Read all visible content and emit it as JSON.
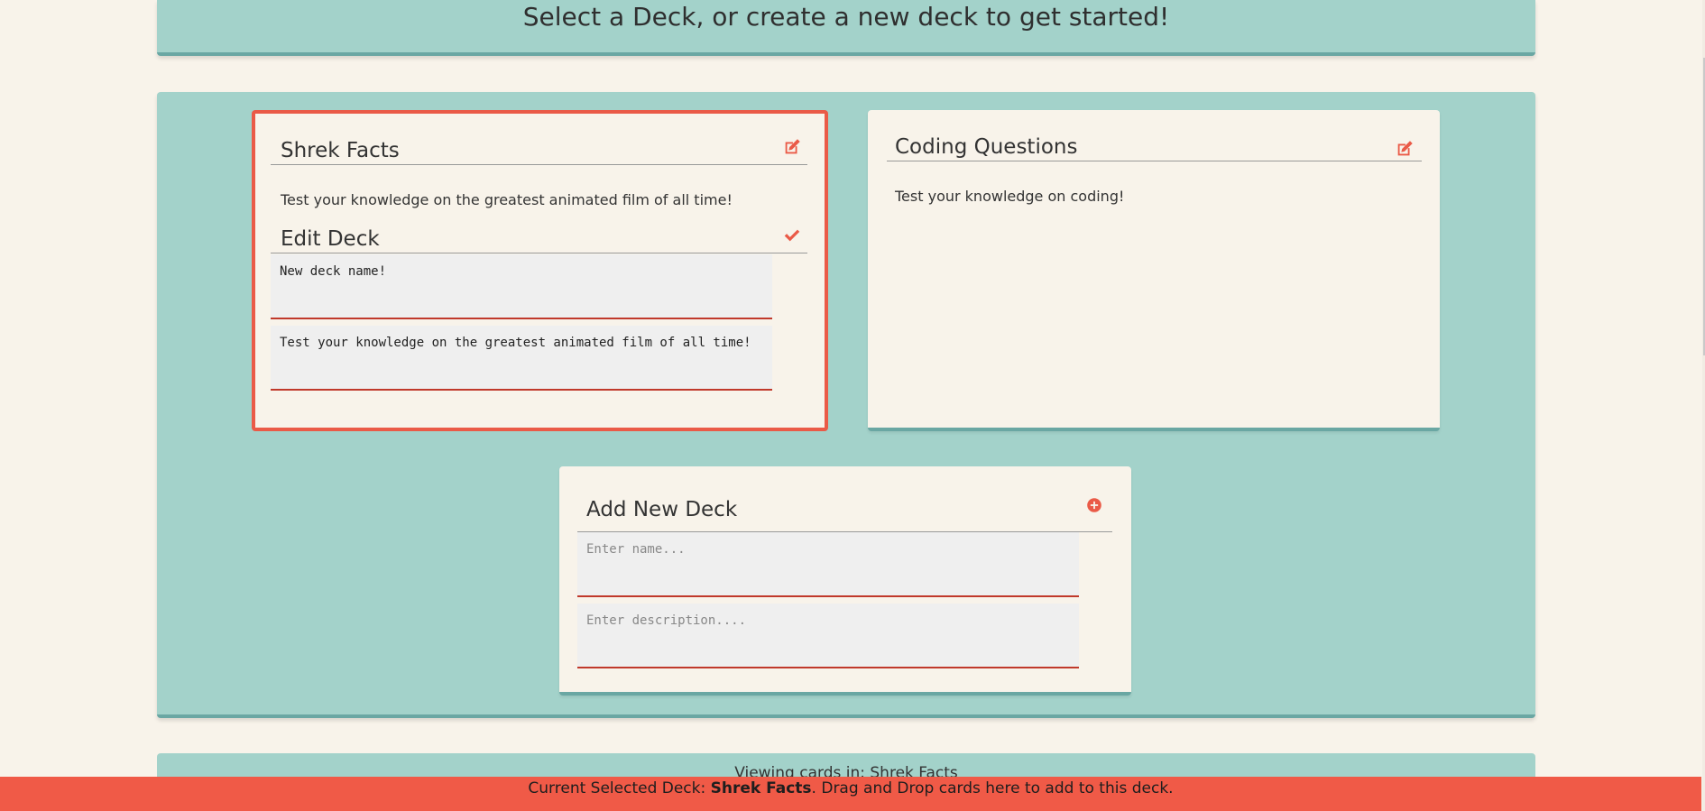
{
  "header": {
    "title": "Select a Deck, or create a new deck to get started!"
  },
  "decks": [
    {
      "title": "Shrek Facts",
      "description": "Test your knowledge on the greatest animated film of all time!",
      "edit_icon": "edit-icon",
      "edit_form": {
        "title": "Edit Deck",
        "confirm_icon": "check-icon",
        "name_value": "New deck name!",
        "description_value": "Test your knowledge on the greatest animated film of all time!"
      }
    },
    {
      "title": "Coding Questions",
      "description": "Test your knowledge on coding!",
      "edit_icon": "edit-icon"
    }
  ],
  "add_deck": {
    "title": "Add New Deck",
    "add_icon": "plus-circle-icon",
    "name_placeholder": "Enter name...",
    "description_placeholder": "Enter description...."
  },
  "viewing": {
    "text": "Viewing cards in: Shrek Facts"
  },
  "footer": {
    "prefix": "Current Selected Deck: ",
    "deck_name": "Shrek Facts",
    "suffix": ". Drag and Drop cards here to add to this deck."
  },
  "colors": {
    "accent": "#ea5a47",
    "panel": "#a3d2ca",
    "background": "#f8f3ea"
  }
}
